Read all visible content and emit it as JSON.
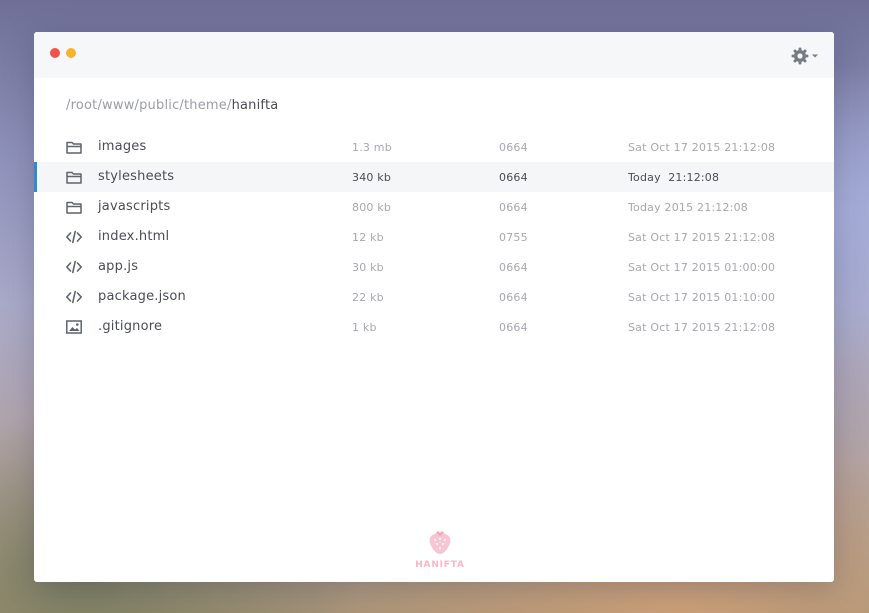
{
  "window": {
    "controls": {
      "close_color": "#ef5546",
      "minimize_color": "#f8b32c"
    },
    "settings_icon": "gear-icon"
  },
  "breadcrumb": {
    "path": "/root/www/public/theme/",
    "current": "hanifta"
  },
  "files": [
    {
      "icon": "folder-icon",
      "name": "images",
      "size": "1.3 mb",
      "permissions": "0664",
      "modified": "Sat Oct 17 2015 21:12:08",
      "selected": false
    },
    {
      "icon": "folder-icon",
      "name": "stylesheets",
      "size": "340 kb",
      "permissions": "0664",
      "modified": "Today  21:12:08",
      "selected": true
    },
    {
      "icon": "folder-icon",
      "name": "javascripts",
      "size": "800 kb",
      "permissions": "0664",
      "modified": "Today 2015 21:12:08",
      "selected": false
    },
    {
      "icon": "code-icon",
      "name": "index.html",
      "size": "12 kb",
      "permissions": "0755",
      "modified": "Sat Oct 17 2015 21:12:08",
      "selected": false
    },
    {
      "icon": "code-icon",
      "name": "app.js",
      "size": "30 kb",
      "permissions": "0664",
      "modified": "Sat Oct 17 2015 01:00:00",
      "selected": false
    },
    {
      "icon": "code-icon",
      "name": "package.json",
      "size": "22 kb",
      "permissions": "0664",
      "modified": "Sat Oct 17 2015 01:10:00",
      "selected": false
    },
    {
      "icon": "image-file-icon",
      "name": ".gitignore",
      "size": "1 kb",
      "permissions": "0664",
      "modified": "Sat Oct 17 2015 21:12:08",
      "selected": false
    }
  ],
  "footer": {
    "logo_text": "HANIFTA",
    "logo_icon": "strawberry-icon"
  },
  "colors": {
    "accent": "#2b8bd3",
    "logo": "#f6b8c7"
  }
}
